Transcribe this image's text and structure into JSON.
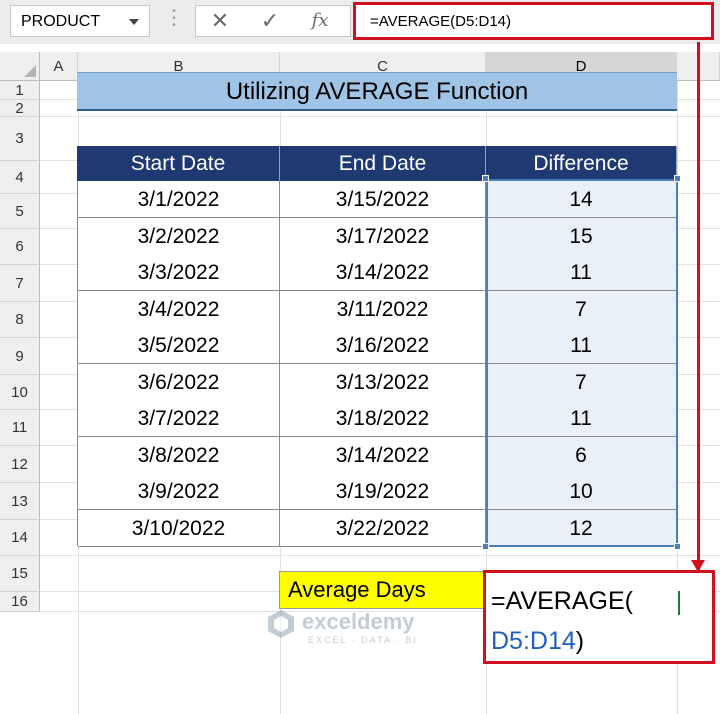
{
  "formula_bar": {
    "name_box": "PRODUCT",
    "cancel_icon": "close-icon",
    "enter_icon": "check-icon",
    "fx_label": "fx",
    "formula": "=AVERAGE(D5:D14)"
  },
  "columns": [
    "A",
    "B",
    "C",
    "D"
  ],
  "rows": [
    "1",
    "2",
    "3",
    "4",
    "5",
    "6",
    "7",
    "8",
    "9",
    "10",
    "11",
    "12",
    "13",
    "14",
    "15",
    "16"
  ],
  "title": "Utilizing AVERAGE Function",
  "table": {
    "headers": [
      "Start  Date",
      "End Date",
      "Difference"
    ],
    "rows": [
      {
        "start": "3/1/2022",
        "end": "3/15/2022",
        "diff": "14"
      },
      {
        "start": "3/2/2022",
        "end": "3/17/2022",
        "diff": "15"
      },
      {
        "start": "3/3/2022",
        "end": "3/14/2022",
        "diff": "11"
      },
      {
        "start": "3/4/2022",
        "end": "3/11/2022",
        "diff": "7"
      },
      {
        "start": "3/5/2022",
        "end": "3/16/2022",
        "diff": "11"
      },
      {
        "start": "3/6/2022",
        "end": "3/13/2022",
        "diff": "7"
      },
      {
        "start": "3/7/2022",
        "end": "3/18/2022",
        "diff": "11"
      },
      {
        "start": "3/8/2022",
        "end": "3/14/2022",
        "diff": "6"
      },
      {
        "start": "3/9/2022",
        "end": "3/19/2022",
        "diff": "10"
      },
      {
        "start": "3/10/2022",
        "end": "3/22/2022",
        "diff": "12"
      }
    ]
  },
  "average": {
    "label": "Average Days",
    "edit_line1": "=AVERAGE(",
    "edit_ref": "D5:D14",
    "edit_close": ")"
  },
  "watermark": {
    "brand": "exceldemy",
    "tagline": "EXCEL · DATA · BI"
  },
  "colors": {
    "header_bg": "#1f3a73",
    "title_bg": "#9fc4e6",
    "highlight": "#d1101f",
    "label_bg": "#ffff00",
    "selection": "#4a7fc1"
  }
}
